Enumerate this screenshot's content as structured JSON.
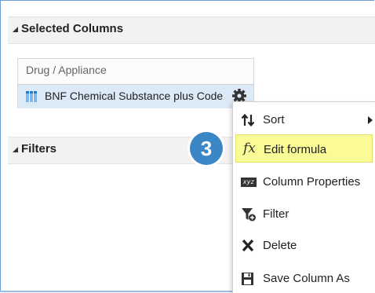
{
  "sections": {
    "selected_columns": {
      "title": "Selected Columns"
    },
    "filters": {
      "title": "Filters"
    }
  },
  "columns_box": {
    "group_label": "Drug / Appliance",
    "column_label": "BNF Chemical Substance plus Code"
  },
  "step_badge": "3",
  "context_menu": {
    "items": [
      {
        "label": "Sort",
        "icon": "sort-icon",
        "has_submenu": true
      },
      {
        "label": "Edit formula",
        "icon": "fx-icon",
        "highlighted": true
      },
      {
        "label": "Column Properties",
        "icon": "xyz-icon"
      },
      {
        "label": "Filter",
        "icon": "filter-icon"
      },
      {
        "label": "Delete",
        "icon": "delete-x-icon"
      },
      {
        "label": "Save Column As",
        "icon": "save-icon"
      }
    ]
  },
  "colors": {
    "highlight": "#fafa96",
    "badge": "#3b86c4",
    "selected_row": "#dce9f6"
  }
}
